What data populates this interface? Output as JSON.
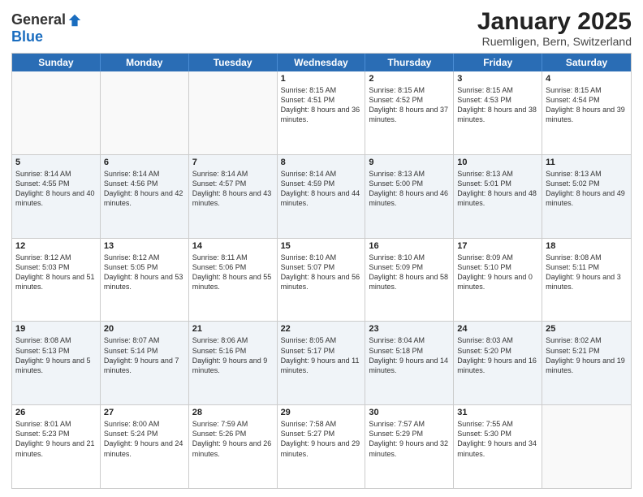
{
  "logo": {
    "general": "General",
    "blue": "Blue"
  },
  "title": "January 2025",
  "location": "Ruemligen, Bern, Switzerland",
  "weekdays": [
    "Sunday",
    "Monday",
    "Tuesday",
    "Wednesday",
    "Thursday",
    "Friday",
    "Saturday"
  ],
  "weeks": [
    [
      {
        "day": "",
        "sunrise": "",
        "sunset": "",
        "daylight": ""
      },
      {
        "day": "",
        "sunrise": "",
        "sunset": "",
        "daylight": ""
      },
      {
        "day": "",
        "sunrise": "",
        "sunset": "",
        "daylight": ""
      },
      {
        "day": "1",
        "sunrise": "Sunrise: 8:15 AM",
        "sunset": "Sunset: 4:51 PM",
        "daylight": "Daylight: 8 hours and 36 minutes."
      },
      {
        "day": "2",
        "sunrise": "Sunrise: 8:15 AM",
        "sunset": "Sunset: 4:52 PM",
        "daylight": "Daylight: 8 hours and 37 minutes."
      },
      {
        "day": "3",
        "sunrise": "Sunrise: 8:15 AM",
        "sunset": "Sunset: 4:53 PM",
        "daylight": "Daylight: 8 hours and 38 minutes."
      },
      {
        "day": "4",
        "sunrise": "Sunrise: 8:15 AM",
        "sunset": "Sunset: 4:54 PM",
        "daylight": "Daylight: 8 hours and 39 minutes."
      }
    ],
    [
      {
        "day": "5",
        "sunrise": "Sunrise: 8:14 AM",
        "sunset": "Sunset: 4:55 PM",
        "daylight": "Daylight: 8 hours and 40 minutes."
      },
      {
        "day": "6",
        "sunrise": "Sunrise: 8:14 AM",
        "sunset": "Sunset: 4:56 PM",
        "daylight": "Daylight: 8 hours and 42 minutes."
      },
      {
        "day": "7",
        "sunrise": "Sunrise: 8:14 AM",
        "sunset": "Sunset: 4:57 PM",
        "daylight": "Daylight: 8 hours and 43 minutes."
      },
      {
        "day": "8",
        "sunrise": "Sunrise: 8:14 AM",
        "sunset": "Sunset: 4:59 PM",
        "daylight": "Daylight: 8 hours and 44 minutes."
      },
      {
        "day": "9",
        "sunrise": "Sunrise: 8:13 AM",
        "sunset": "Sunset: 5:00 PM",
        "daylight": "Daylight: 8 hours and 46 minutes."
      },
      {
        "day": "10",
        "sunrise": "Sunrise: 8:13 AM",
        "sunset": "Sunset: 5:01 PM",
        "daylight": "Daylight: 8 hours and 48 minutes."
      },
      {
        "day": "11",
        "sunrise": "Sunrise: 8:13 AM",
        "sunset": "Sunset: 5:02 PM",
        "daylight": "Daylight: 8 hours and 49 minutes."
      }
    ],
    [
      {
        "day": "12",
        "sunrise": "Sunrise: 8:12 AM",
        "sunset": "Sunset: 5:03 PM",
        "daylight": "Daylight: 8 hours and 51 minutes."
      },
      {
        "day": "13",
        "sunrise": "Sunrise: 8:12 AM",
        "sunset": "Sunset: 5:05 PM",
        "daylight": "Daylight: 8 hours and 53 minutes."
      },
      {
        "day": "14",
        "sunrise": "Sunrise: 8:11 AM",
        "sunset": "Sunset: 5:06 PM",
        "daylight": "Daylight: 8 hours and 55 minutes."
      },
      {
        "day": "15",
        "sunrise": "Sunrise: 8:10 AM",
        "sunset": "Sunset: 5:07 PM",
        "daylight": "Daylight: 8 hours and 56 minutes."
      },
      {
        "day": "16",
        "sunrise": "Sunrise: 8:10 AM",
        "sunset": "Sunset: 5:09 PM",
        "daylight": "Daylight: 8 hours and 58 minutes."
      },
      {
        "day": "17",
        "sunrise": "Sunrise: 8:09 AM",
        "sunset": "Sunset: 5:10 PM",
        "daylight": "Daylight: 9 hours and 0 minutes."
      },
      {
        "day": "18",
        "sunrise": "Sunrise: 8:08 AM",
        "sunset": "Sunset: 5:11 PM",
        "daylight": "Daylight: 9 hours and 3 minutes."
      }
    ],
    [
      {
        "day": "19",
        "sunrise": "Sunrise: 8:08 AM",
        "sunset": "Sunset: 5:13 PM",
        "daylight": "Daylight: 9 hours and 5 minutes."
      },
      {
        "day": "20",
        "sunrise": "Sunrise: 8:07 AM",
        "sunset": "Sunset: 5:14 PM",
        "daylight": "Daylight: 9 hours and 7 minutes."
      },
      {
        "day": "21",
        "sunrise": "Sunrise: 8:06 AM",
        "sunset": "Sunset: 5:16 PM",
        "daylight": "Daylight: 9 hours and 9 minutes."
      },
      {
        "day": "22",
        "sunrise": "Sunrise: 8:05 AM",
        "sunset": "Sunset: 5:17 PM",
        "daylight": "Daylight: 9 hours and 11 minutes."
      },
      {
        "day": "23",
        "sunrise": "Sunrise: 8:04 AM",
        "sunset": "Sunset: 5:18 PM",
        "daylight": "Daylight: 9 hours and 14 minutes."
      },
      {
        "day": "24",
        "sunrise": "Sunrise: 8:03 AM",
        "sunset": "Sunset: 5:20 PM",
        "daylight": "Daylight: 9 hours and 16 minutes."
      },
      {
        "day": "25",
        "sunrise": "Sunrise: 8:02 AM",
        "sunset": "Sunset: 5:21 PM",
        "daylight": "Daylight: 9 hours and 19 minutes."
      }
    ],
    [
      {
        "day": "26",
        "sunrise": "Sunrise: 8:01 AM",
        "sunset": "Sunset: 5:23 PM",
        "daylight": "Daylight: 9 hours and 21 minutes."
      },
      {
        "day": "27",
        "sunrise": "Sunrise: 8:00 AM",
        "sunset": "Sunset: 5:24 PM",
        "daylight": "Daylight: 9 hours and 24 minutes."
      },
      {
        "day": "28",
        "sunrise": "Sunrise: 7:59 AM",
        "sunset": "Sunset: 5:26 PM",
        "daylight": "Daylight: 9 hours and 26 minutes."
      },
      {
        "day": "29",
        "sunrise": "Sunrise: 7:58 AM",
        "sunset": "Sunset: 5:27 PM",
        "daylight": "Daylight: 9 hours and 29 minutes."
      },
      {
        "day": "30",
        "sunrise": "Sunrise: 7:57 AM",
        "sunset": "Sunset: 5:29 PM",
        "daylight": "Daylight: 9 hours and 32 minutes."
      },
      {
        "day": "31",
        "sunrise": "Sunrise: 7:55 AM",
        "sunset": "Sunset: 5:30 PM",
        "daylight": "Daylight: 9 hours and 34 minutes."
      },
      {
        "day": "",
        "sunrise": "",
        "sunset": "",
        "daylight": ""
      }
    ]
  ]
}
